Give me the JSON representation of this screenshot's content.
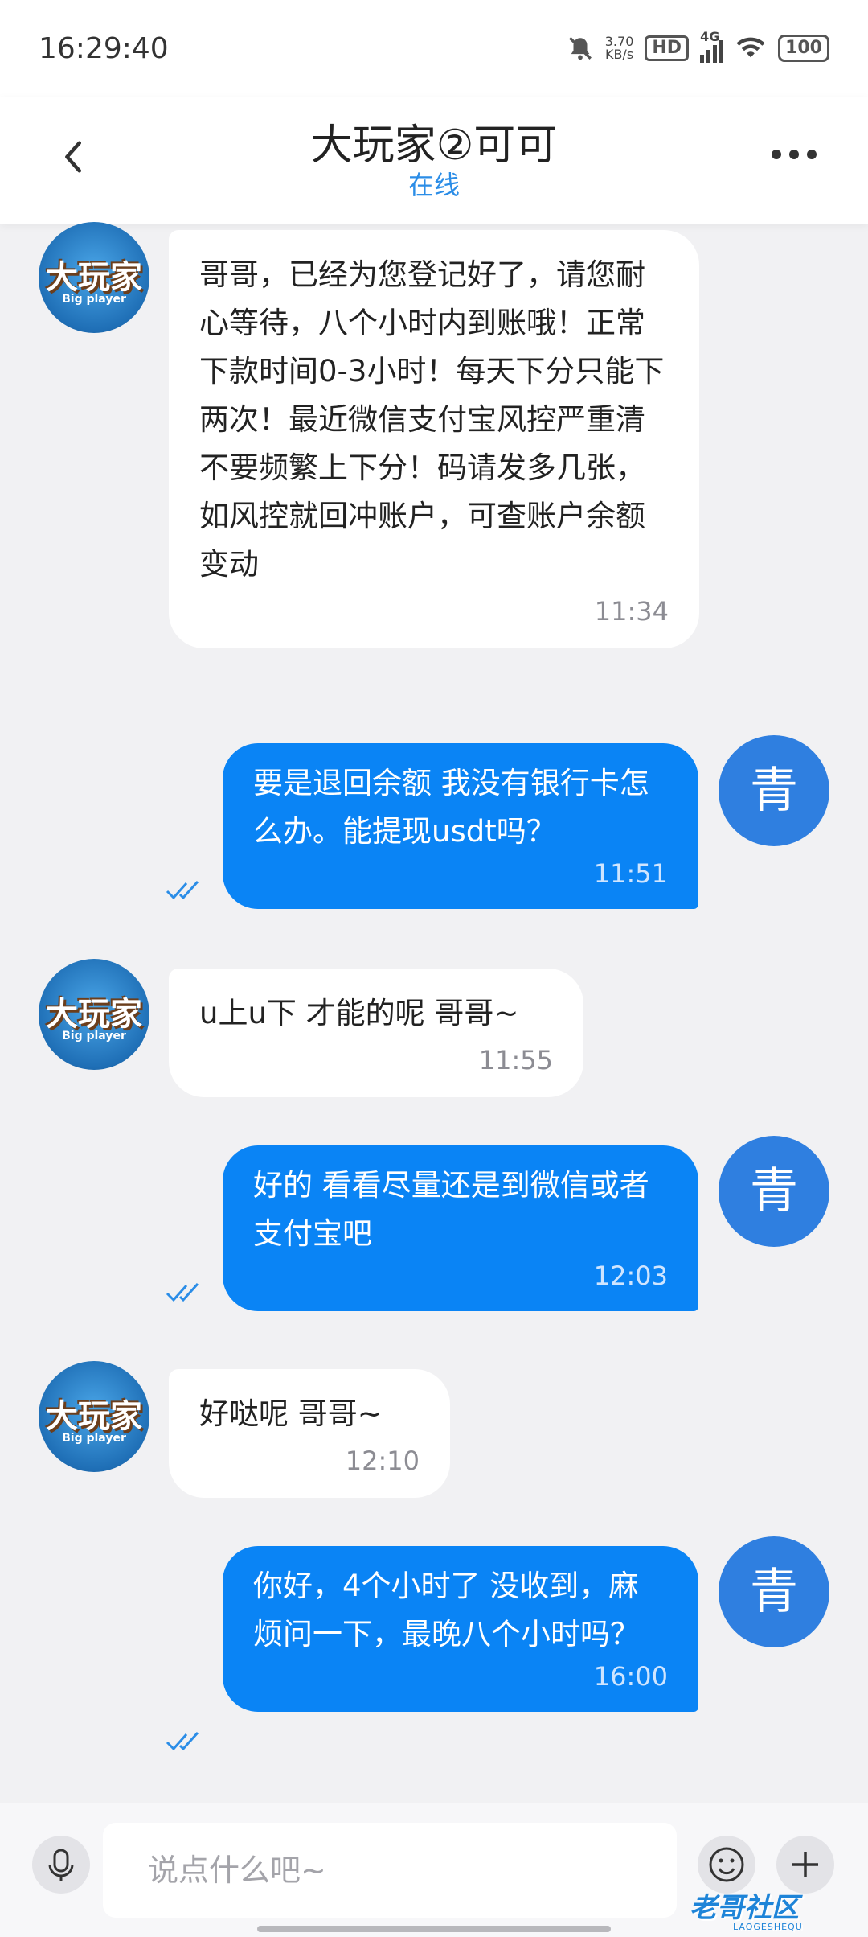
{
  "status_bar": {
    "time": "16:29:40",
    "speed_value": "3.70",
    "speed_unit": "KB/s",
    "hd": "HD",
    "network": "4G",
    "battery": "100"
  },
  "header": {
    "title": "大玩家②可可",
    "status": "在线"
  },
  "contact_avatar": {
    "logo_text": "大玩家",
    "logo_sub": "Big player"
  },
  "me_avatar_char": "青",
  "messages": [
    {
      "side": "left",
      "text": "哥哥，已经为您登记好了，请您耐心等待，八个小时内到账哦！正常下款时间0-3小时！每天下分只能下两次！最近微信支付宝风控严重清不要频繁上下分！码请发多几张，如风控就回冲账户，可查账户余额变动",
      "time": "11:34"
    },
    {
      "side": "right",
      "text": "要是退回余额 我没有银行卡怎么办。能提现usdt吗？",
      "time": "11:51"
    },
    {
      "side": "left",
      "text": "u上u下 才能的呢 哥哥~",
      "time": "11:55"
    },
    {
      "side": "right",
      "text": "好的 看看尽量还是到微信或者支付宝吧",
      "time": "12:03"
    },
    {
      "side": "left",
      "text": "好哒呢 哥哥~",
      "time": "12:10"
    },
    {
      "side": "right",
      "text": "你好，4个小时了 没收到，麻烦问一下，最晚八个小时吗？",
      "time": "16:00"
    }
  ],
  "input": {
    "placeholder": "说点什么吧~"
  },
  "watermark": {
    "text": "老哥社区",
    "sub": "LAOGESHEQU"
  },
  "colors": {
    "accent": "#0a84f5",
    "status_online": "#2b8de7",
    "background": "#f1f1f3"
  }
}
